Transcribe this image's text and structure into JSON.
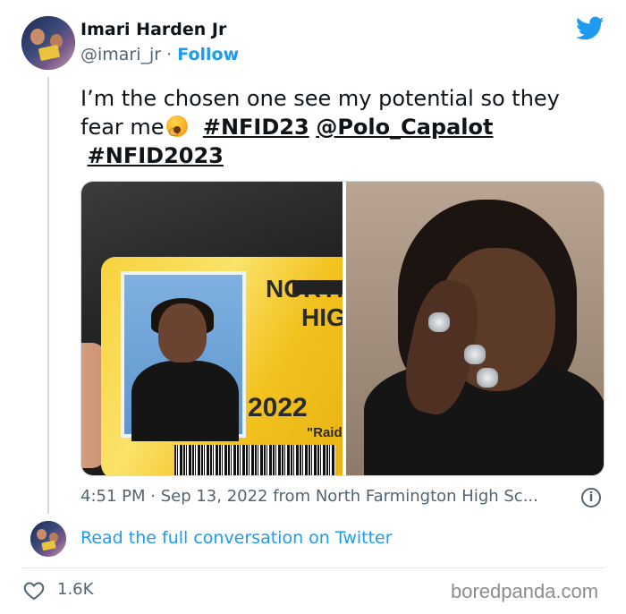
{
  "author": {
    "name": "Imari Harden Jr",
    "handle": "@imari_jr",
    "separator": "·",
    "follow_label": "Follow"
  },
  "tweet": {
    "text_start": "I’m the chosen one see my potential so they fear me",
    "emoji": "yawning-face-emoji",
    "hashtag1": "#NFID23",
    "mention": "@Polo_Capalot",
    "hashtag2": "#NFID2023"
  },
  "media": {
    "left_image": {
      "school_line1": "NORTH",
      "school_line2": "HIG",
      "year": "2022",
      "team": "\"Raid"
    },
    "right_image": "portrait-photo"
  },
  "meta": {
    "timestamp": "4:51 PM · Sep 13, 2022 from North Farmington High Sc..."
  },
  "conversation_link": "Read the full conversation on Twitter",
  "likes_count": "1.6K",
  "watermark": "boredpanda.com",
  "colors": {
    "link_blue": "#1d9bf0",
    "text": "#0f1419",
    "muted": "#536471"
  }
}
